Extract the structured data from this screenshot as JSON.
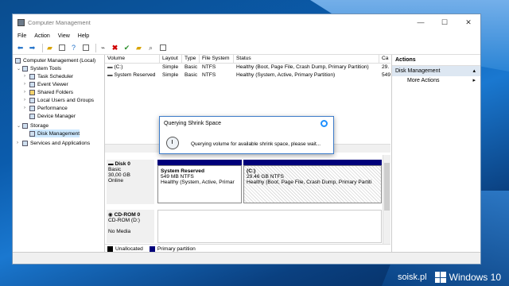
{
  "window": {
    "title": "Computer Management",
    "controls": {
      "minimize": "—",
      "maximize": "☐",
      "close": "✕"
    }
  },
  "menu": [
    "File",
    "Action",
    "View",
    "Help"
  ],
  "tree": {
    "root": "Computer Management (Local)",
    "system_tools": "System Tools",
    "task_scheduler": "Task Scheduler",
    "event_viewer": "Event Viewer",
    "shared_folders": "Shared Folders",
    "local_users": "Local Users and Groups",
    "performance": "Performance",
    "device_manager": "Device Manager",
    "storage": "Storage",
    "disk_management": "Disk Management",
    "services": "Services and Applications"
  },
  "volume_list": {
    "columns": [
      "Volume",
      "Layout",
      "Type",
      "File System",
      "Status",
      "Ca"
    ],
    "rows": [
      {
        "volume": "(C:)",
        "layout": "Simple",
        "type": "Basic",
        "fs": "NTFS",
        "status": "Healthy (Boot, Page File, Crash Dump, Primary Partition)",
        "cap": "29."
      },
      {
        "volume": "System Reserved",
        "layout": "Simple",
        "type": "Basic",
        "fs": "NTFS",
        "status": "Healthy (System, Active, Primary Partition)",
        "cap": "549"
      }
    ]
  },
  "disks": {
    "disk0": {
      "name": "Disk 0",
      "type": "Basic",
      "size": "30,00 GB",
      "state": "Online"
    },
    "sysres": {
      "name": "System Reserved",
      "size": "549 MB NTFS",
      "status": "Healthy (System, Active, Primar"
    },
    "c": {
      "name": "(C:)",
      "size": "29.46 GB NTFS",
      "status": "Healthy (Boot, Page File, Crash Dump, Primary Partiti"
    },
    "cdrom": {
      "name": "CD-ROM 0",
      "drive": "CD-ROM (D:)",
      "media": "No Media"
    }
  },
  "legend": {
    "unallocated": "Unallocated",
    "primary": "Primary partition"
  },
  "actions": {
    "header": "Actions",
    "section": "Disk Management",
    "more": "More Actions"
  },
  "dialog": {
    "title": "Querying Shrink Space",
    "message": "Querying volume for available shrink space, please wait..."
  },
  "watermark": {
    "site": "soisk.pl",
    "brand": "Windows 10"
  },
  "colors": {
    "primary_partition": "#00007a",
    "accent": "#3c7bc9"
  }
}
